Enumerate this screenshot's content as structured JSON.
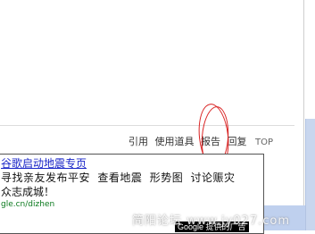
{
  "post_actions": {
    "quote": "引用",
    "use_tool": "使用道具",
    "report": "报告",
    "reply": "回复",
    "top": "TOP"
  },
  "ad": {
    "title": "谷歌启动地震专页",
    "line2_items": [
      "寻找亲友发布平安",
      "查看地震",
      "形势图",
      "讨论赈灾"
    ],
    "line3": "众志成城！",
    "url": "gle.cn/dizhen",
    "badge": "Google 提供的广告"
  },
  "watermark": "简阳论坛  www.jy027.com",
  "colors": {
    "annotation_circle": "#d92121",
    "ad_link": "#1a26c8",
    "ad_url": "#0b7a1e",
    "scroll_blue": "#c8d6ee"
  }
}
